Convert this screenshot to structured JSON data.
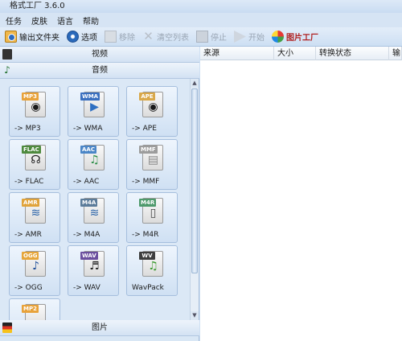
{
  "window": {
    "title": "格式工厂 3.6.0"
  },
  "menu": [
    "任务",
    "皮肤",
    "语言",
    "帮助"
  ],
  "toolbar": {
    "output_folder": "输出文件夹",
    "options": "选项",
    "remove": "移除",
    "clear_list": "清空列表",
    "stop": "停止",
    "start": "开始",
    "picture_factory": "图片工厂"
  },
  "categories": {
    "video": "视频",
    "audio": "音频",
    "picture": "图片"
  },
  "audio_formats": [
    {
      "badge": "MP3",
      "label": "-> MP3",
      "badge_color": "#e8a23a",
      "icon": "speaker-icon"
    },
    {
      "badge": "WMA",
      "label": "-> WMA",
      "badge_color": "#3a6fbf",
      "icon": "play-icon"
    },
    {
      "badge": "APE",
      "label": "-> APE",
      "badge_color": "#d9a84a",
      "icon": "speaker-icon"
    },
    {
      "badge": "FLAC",
      "label": "-> FLAC",
      "badge_color": "#4e8a3e",
      "icon": "headphones-icon"
    },
    {
      "badge": "AAC",
      "label": "-> AAC",
      "badge_color": "#4b86c7",
      "icon": "music-icon"
    },
    {
      "badge": "MMF",
      "label": "-> MMF",
      "badge_color": "#9c9c9c",
      "icon": "document-icon"
    },
    {
      "badge": "AMR",
      "label": "-> AMR",
      "badge_color": "#e0a33b",
      "icon": "waveform-icon"
    },
    {
      "badge": "M4A",
      "label": "-> M4A",
      "badge_color": "#5c7c9a",
      "icon": "waveform-icon"
    },
    {
      "badge": "M4R",
      "label": "-> M4R",
      "badge_color": "#4f9a6c",
      "icon": "phone-icon"
    },
    {
      "badge": "OGG",
      "label": "-> OGG",
      "badge_color": "#e6a63a",
      "icon": "music-note-icon"
    },
    {
      "badge": "WAV",
      "label": "-> WAV",
      "badge_color": "#6b4f9e",
      "icon": "music-notes-icon"
    },
    {
      "badge": "WV",
      "label": "WavPack",
      "badge_color": "#3d3d3d",
      "icon": "music-note-icon"
    },
    {
      "badge": "MP2",
      "label": "",
      "badge_color": "#e8a23a",
      "icon": "speaker-icon"
    }
  ],
  "task_table": {
    "columns": [
      "来源",
      "大小",
      "转换状态",
      "输出"
    ]
  }
}
